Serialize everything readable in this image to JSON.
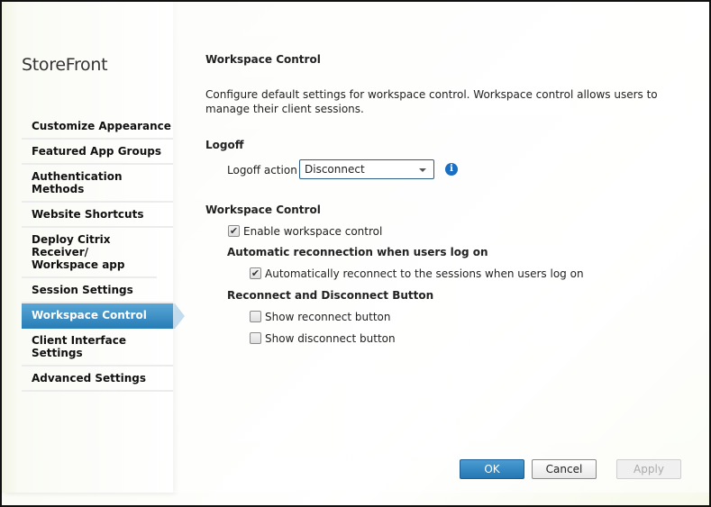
{
  "sidebar": {
    "title": "StoreFront",
    "items": [
      {
        "label": "Customize Appearance"
      },
      {
        "label": "Featured App Groups"
      },
      {
        "label": "Authentication Methods"
      },
      {
        "label": "Website Shortcuts"
      },
      {
        "label": "Deploy Citrix Receiver/ Workspace app"
      },
      {
        "label": "Session Settings"
      },
      {
        "label": "Workspace Control",
        "active": true
      },
      {
        "label": "Client Interface Settings"
      },
      {
        "label": "Advanced Settings"
      }
    ]
  },
  "main": {
    "title": "Workspace Control",
    "description": "Configure default settings for workspace control. Workspace control allows users to manage their client sessions.",
    "logoff": {
      "heading": "Logoff",
      "action_label": "Logoff action",
      "action_value": "Disconnect",
      "info_icon": "info-icon"
    },
    "workspace": {
      "heading": "Workspace Control",
      "enable_label": "Enable workspace control",
      "enable_checked": true,
      "auto_heading": "Automatic reconnection when users log on",
      "auto_label": "Automatically reconnect to the sessions when users log on",
      "auto_checked": true,
      "buttons_heading": "Reconnect and Disconnect Button",
      "show_reconnect": "Show reconnect button",
      "show_reconnect_checked": false,
      "show_disconnect": "Show disconnect button",
      "show_disconnect_checked": false
    }
  },
  "footer": {
    "ok": "OK",
    "cancel": "Cancel",
    "apply": "Apply"
  },
  "colors": {
    "accent": "#2a7fb8",
    "info": "#1b6fc2"
  }
}
